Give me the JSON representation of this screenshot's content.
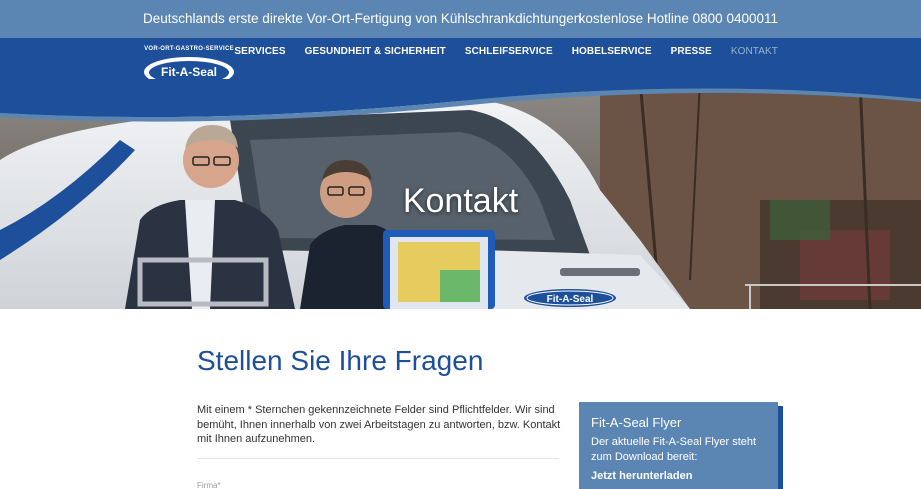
{
  "topbar": {
    "tagline": "Deutschlands erste direkte Vor-Ort-Fertigung von Kühlschrankdichtungen",
    "hotline": "kostenlose Hotline 0800 0400011"
  },
  "logo": {
    "tagline": "VOR-ORT-GASTRO-SERVICE",
    "name": "Fit-A-Seal"
  },
  "nav": {
    "items": [
      {
        "label": "SERVICES"
      },
      {
        "label": "GESUNDHEIT & SICHERHEIT"
      },
      {
        "label": "SCHLEIFSERVICE"
      },
      {
        "label": "HOBELSERVICE"
      },
      {
        "label": "PRESSE"
      },
      {
        "label": "KONTAKT"
      }
    ]
  },
  "hero": {
    "title": "Kontakt",
    "van_logo_text": "Fit-A-Seal"
  },
  "main": {
    "title": "Stellen Sie Ihre Fragen",
    "intro": "Mit einem * Sternchen gekennzeichnete Felder sind Pflichtfelder. Wir sind bemüht, Ihnen innerhalb von zwei Arbeitstagen zu antworten, bzw. Kontakt mit Ihnen aufzunehmen.",
    "form": {
      "firma_label": "Firma*"
    }
  },
  "flyer": {
    "title": "Fit-A-Seal Flyer",
    "text": "Der aktuelle Fit-A-Seal Flyer steht zum Download bereit:",
    "link": "Jetzt herunterladen"
  },
  "colors": {
    "topbar": "#5b86b3",
    "header": "#1d4f9a",
    "title_blue": "#1d4f9a"
  }
}
